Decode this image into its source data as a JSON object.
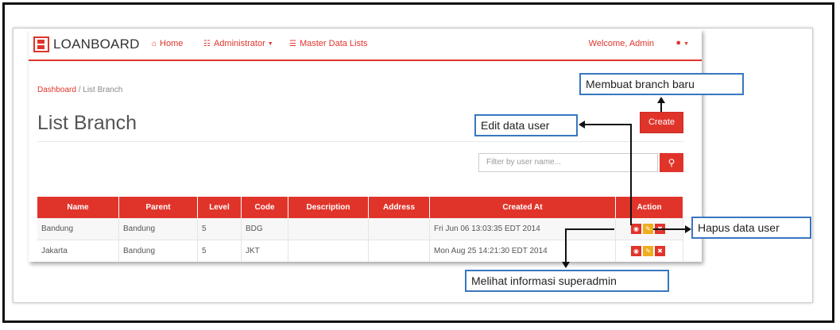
{
  "navbar": {
    "brand": "LOANBOARD",
    "home": "Home",
    "administrator": "Administrator",
    "master_data": "Master Data Lists",
    "welcome": "Welcome, Admin"
  },
  "breadcrumb": {
    "root": "Dashboard",
    "separator": "/",
    "current": "List Branch"
  },
  "page": {
    "title": "List Branch",
    "create_label": "Create",
    "filter_placeholder": "Filter by user name..."
  },
  "table": {
    "headers": [
      "Name",
      "Parent",
      "Level",
      "Code",
      "Description",
      "Address",
      "Created At",
      "Action"
    ],
    "rows": [
      {
        "name": "Bandung",
        "parent": "Bandung",
        "level": "5",
        "code": "BDG",
        "description": "",
        "address": "",
        "created_at": "Fri Jun 06 13:03:35 EDT 2014"
      },
      {
        "name": "Jakarta",
        "parent": "Bandung",
        "level": "5",
        "code": "JKT",
        "description": "",
        "address": "",
        "created_at": "Mon Aug 25 14:21:30 EDT 2014"
      }
    ]
  },
  "annotations": {
    "create": "Membuat branch baru",
    "edit": "Edit data user",
    "delete": "Hapus data user",
    "view": "Melihat informasi superadmin"
  },
  "colors": {
    "accent": "#e0342b",
    "edit": "#f0ad1e",
    "callout_border": "#3976c0"
  }
}
